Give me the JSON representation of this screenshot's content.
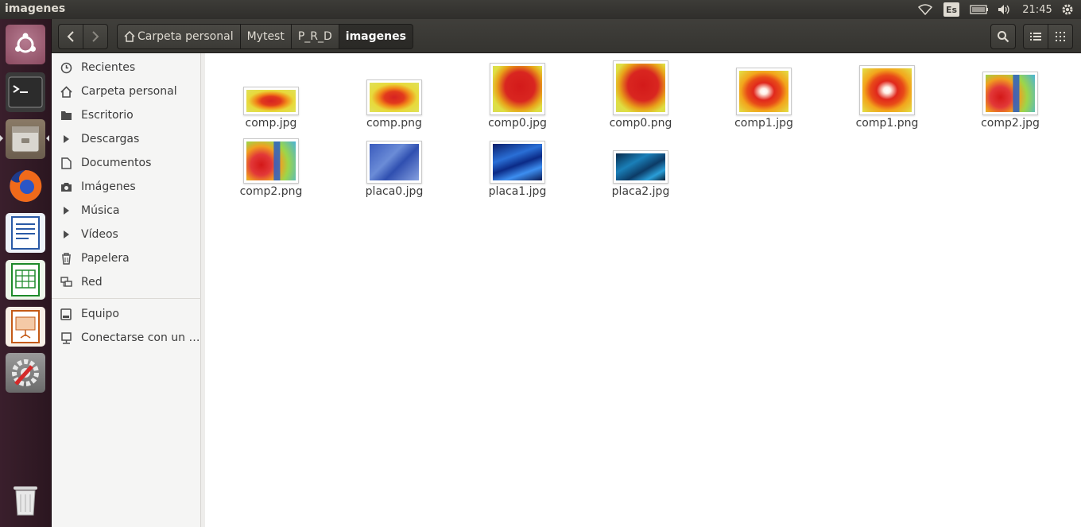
{
  "window": {
    "title": "imagenes"
  },
  "panel": {
    "keyboard_layout": "Es",
    "time": "21:45"
  },
  "launcher": {
    "items": [
      {
        "name": "ubuntu-dash"
      },
      {
        "name": "terminal"
      },
      {
        "name": "files"
      },
      {
        "name": "firefox"
      },
      {
        "name": "libreoffice-writer"
      },
      {
        "name": "libreoffice-calc"
      },
      {
        "name": "libreoffice-impress"
      },
      {
        "name": "system-settings"
      },
      {
        "name": "trash"
      }
    ]
  },
  "pathbar": {
    "items": [
      {
        "label": "Carpeta personal",
        "icon": "home-icon"
      },
      {
        "label": "Mytest"
      },
      {
        "label": "P_R_D"
      },
      {
        "label": "imagenes",
        "active": true
      }
    ]
  },
  "sidebar": {
    "items": [
      {
        "label": "Recientes",
        "icon": "clock-icon"
      },
      {
        "label": "Carpeta personal",
        "icon": "home-icon"
      },
      {
        "label": "Escritorio",
        "icon": "folder-icon"
      },
      {
        "label": "Descargas",
        "icon": "download-icon"
      },
      {
        "label": "Documentos",
        "icon": "document-icon"
      },
      {
        "label": "Imágenes",
        "icon": "camera-icon"
      },
      {
        "label": "Música",
        "icon": "music-icon"
      },
      {
        "label": "Vídeos",
        "icon": "video-icon"
      },
      {
        "label": "Papelera",
        "icon": "trash-icon"
      },
      {
        "label": "Red",
        "icon": "network-icon"
      }
    ],
    "devices": [
      {
        "label": "Equipo",
        "icon": "drive-icon"
      },
      {
        "label": "Conectarse con un …",
        "icon": "server-icon"
      }
    ]
  },
  "files": [
    {
      "name": "comp.jpg",
      "style": "heat-yellow"
    },
    {
      "name": "comp.png",
      "style": "heat-yellow"
    },
    {
      "name": "comp0.jpg",
      "style": "heat-chip"
    },
    {
      "name": "comp0.png",
      "style": "heat-chip"
    },
    {
      "name": "comp1.jpg",
      "style": "heat-white"
    },
    {
      "name": "comp1.png",
      "style": "heat-white"
    },
    {
      "name": "comp2.jpg",
      "style": "heat-rainbow"
    },
    {
      "name": "comp2.png",
      "style": "heat-rainbow"
    },
    {
      "name": "placa0.jpg",
      "style": "pcb-0"
    },
    {
      "name": "placa1.jpg",
      "style": "pcb-1"
    },
    {
      "name": "placa2.jpg",
      "style": "pcb-2"
    }
  ]
}
